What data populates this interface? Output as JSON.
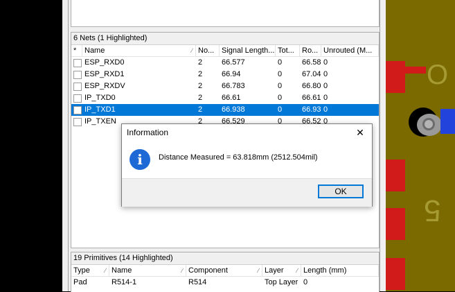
{
  "nets_panel": {
    "header": "6 Nets (1 Highlighted)",
    "columns": [
      "*",
      "Name",
      "No...",
      "Signal Length...",
      "Tot...",
      "Ro...",
      "Unrouted (M..."
    ],
    "rows": [
      {
        "name": "ESP_RXD0",
        "nodes": "2",
        "signal": "66.577",
        "total": "0",
        "routed": "66.58",
        "unrouted": "0",
        "selected": false
      },
      {
        "name": "ESP_RXD1",
        "nodes": "2",
        "signal": "66.94",
        "total": "0",
        "routed": "67.04",
        "unrouted": "0",
        "selected": false
      },
      {
        "name": "ESP_RXDV",
        "nodes": "2",
        "signal": "66.783",
        "total": "0",
        "routed": "66.80",
        "unrouted": "0",
        "selected": false
      },
      {
        "name": "IP_TXD0",
        "nodes": "2",
        "signal": "66.61",
        "total": "0",
        "routed": "66.61",
        "unrouted": "0",
        "selected": false
      },
      {
        "name": "IP_TXD1",
        "nodes": "2",
        "signal": "66.938",
        "total": "0",
        "routed": "66.93",
        "unrouted": "0",
        "selected": true
      },
      {
        "name": "IP_TXEN",
        "nodes": "2",
        "signal": "66.529",
        "total": "0",
        "routed": "66.52",
        "unrouted": "0",
        "selected": false
      }
    ]
  },
  "primitives_panel": {
    "header": "19 Primitives (14 Highlighted)",
    "columns": [
      "Type",
      "Name",
      "Component",
      "Layer",
      "Length (mm)"
    ],
    "rows": [
      {
        "type": "Pad",
        "name": "R514-1",
        "component": "R514",
        "layer": "Top Layer",
        "length": "0"
      }
    ]
  },
  "dialog": {
    "title": "Information",
    "close_glyph": "✕",
    "icon_glyph": "i",
    "message": "Distance Measured = 63.818mm (2512.504mil)",
    "ok_label": "OK"
  },
  "pcb_silk": {
    "digit": "5",
    "letter": "O"
  },
  "colors": {
    "selection": "#0078d7",
    "pcb_board": "#7b6a00",
    "pad": "#d11b1b",
    "info_icon": "#1d6ad6"
  }
}
